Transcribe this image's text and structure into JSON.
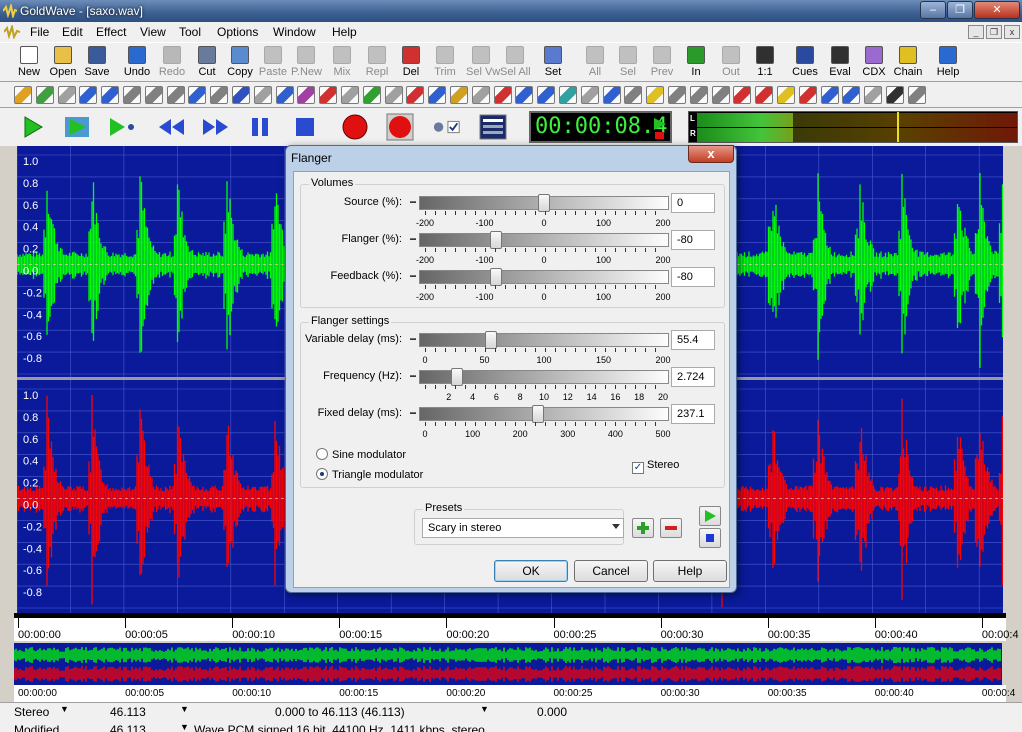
{
  "window": {
    "title": "GoldWave - [saxo.wav]",
    "min_glyph": "–",
    "max_glyph": "❐",
    "close_glyph": "✕"
  },
  "menu": [
    "File",
    "Edit",
    "Effect",
    "View",
    "Tool",
    "Options",
    "Window",
    "Help"
  ],
  "mdi": {
    "min": "_",
    "restore": "❐",
    "close": "x"
  },
  "toolbar": [
    {
      "label": "New",
      "icon": "new-file-icon",
      "color": "#ffffff",
      "enabled": true
    },
    {
      "label": "Open",
      "icon": "open-folder-icon",
      "color": "#e8c048",
      "enabled": true
    },
    {
      "label": "Save",
      "icon": "save-disk-icon",
      "color": "#3a5a9a",
      "enabled": true
    },
    {
      "label": "Undo",
      "icon": "undo-arrow-icon",
      "color": "#2a6ad0",
      "enabled": true
    },
    {
      "label": "Redo",
      "icon": "redo-arrow-icon",
      "color": "#b8b8b8",
      "enabled": false
    },
    {
      "label": "Cut",
      "icon": "scissors-icon",
      "color": "#6a7a9a",
      "enabled": true
    },
    {
      "label": "Copy",
      "icon": "copy-icon",
      "color": "#5a8ad0",
      "enabled": true
    },
    {
      "label": "Paste",
      "icon": "paste-icon",
      "color": "#c0c0c0",
      "enabled": false
    },
    {
      "label": "P.New",
      "icon": "paste-new-icon",
      "color": "#c0c0c0",
      "enabled": false
    },
    {
      "label": "Mix",
      "icon": "mix-icon",
      "color": "#c0c0c0",
      "enabled": false
    },
    {
      "label": "Repl",
      "icon": "replace-icon",
      "color": "#c0c0c0",
      "enabled": false
    },
    {
      "label": "Del",
      "icon": "delete-icon",
      "color": "#d03030",
      "enabled": true
    },
    {
      "label": "Trim",
      "icon": "trim-icon",
      "color": "#c0c0c0",
      "enabled": false
    },
    {
      "label": "Sel Vw",
      "icon": "select-view-icon",
      "color": "#c0c0c0",
      "enabled": false
    },
    {
      "label": "Sel All",
      "icon": "select-all-icon",
      "color": "#c0c0c0",
      "enabled": false
    },
    {
      "label": "Set",
      "icon": "set-marker-icon",
      "color": "#5a7ad0",
      "enabled": true
    },
    {
      "label": "All",
      "icon": "zoom-all-icon",
      "color": "#c0c0c0",
      "enabled": false
    },
    {
      "label": "Sel",
      "icon": "zoom-selection-icon",
      "color": "#c0c0c0",
      "enabled": false
    },
    {
      "label": "Prev",
      "icon": "zoom-previous-icon",
      "color": "#c0c0c0",
      "enabled": false
    },
    {
      "label": "In",
      "icon": "zoom-in-icon",
      "color": "#2a9a2a",
      "enabled": true
    },
    {
      "label": "Out",
      "icon": "zoom-out-icon",
      "color": "#c0c0c0",
      "enabled": false
    },
    {
      "label": "1:1",
      "icon": "zoom-one-to-one-icon",
      "color": "#303030",
      "enabled": true
    },
    {
      "label": "Cues",
      "icon": "cues-icon",
      "color": "#2a4aa0",
      "enabled": true
    },
    {
      "label": "Eval",
      "icon": "expression-evaluator-icon",
      "color": "#303030",
      "enabled": true
    },
    {
      "label": "CDX",
      "icon": "cd-extract-icon",
      "color": "#9a6ad0",
      "enabled": true
    },
    {
      "label": "Chain",
      "icon": "chain-wizard-icon",
      "color": "#e0c020",
      "enabled": true
    },
    {
      "label": "Help",
      "icon": "help-icon",
      "color": "#2a6ad0",
      "enabled": true
    }
  ],
  "effects_bar_colors": [
    "#e0a020",
    "#40a040",
    "#a0a0a0",
    "#3060d0",
    "#3060d0",
    "#808080",
    "#808080",
    "#808080",
    "#3060d0",
    "#808080",
    "#3050c0",
    "#a0a0a0",
    "#3060d0",
    "#a040a0",
    "#d03030",
    "#a0a0a0",
    "#30a030",
    "#a0a0a0",
    "#d03030",
    "#3060d0",
    "#d0a020",
    "#a0a0a0",
    "#d03030",
    "#3060d0",
    "#3060d0",
    "#30a0a0",
    "#a0a0a0",
    "#3060d0",
    "#808080",
    "#e0c020",
    "#808080",
    "#808080",
    "#808080",
    "#d03030",
    "#d03030",
    "#e0c020",
    "#d03030",
    "#3060d0",
    "#3060d0",
    "#a0a0a0",
    "#303030",
    "#808080"
  ],
  "transport": {
    "time": "00:00:08.4",
    "vu_left": "L",
    "vu_right": "R"
  },
  "waveform": {
    "left_color": "#00ff00",
    "right_color": "#ff0000",
    "background": "#0a1a9a",
    "amplitude_labels": [
      "1.0",
      "0.8",
      "0.6",
      "0.4",
      "0.2",
      "0.0",
      "-0.2",
      "-0.4",
      "-0.6",
      "-0.8"
    ],
    "duration_s": 46.113
  },
  "timeline": {
    "labels": [
      "00:00:00",
      "00:00:05",
      "00:00:10",
      "00:00:15",
      "00:00:20",
      "00:00:25",
      "00:00:30",
      "00:00:35",
      "00:00:40",
      "00:00:4"
    ]
  },
  "overview": {
    "labels": [
      "00:00:00",
      "00:00:05",
      "00:00:10",
      "00:00:15",
      "00:00:20",
      "00:00:25",
      "00:00:30",
      "00:00:35",
      "00:00:40",
      "00:00:4"
    ]
  },
  "status": {
    "row1": [
      "Stereo",
      "46.113",
      "0.000 to 46.113 (46.113)",
      "0.000"
    ],
    "row2": [
      "Modified",
      "46.113",
      "Wave PCM signed 16 bit, 44100 Hz, 1411 kbps, stereo"
    ]
  },
  "dialog": {
    "title": "Flanger",
    "close_glyph": "x",
    "volumes_group": "Volumes",
    "flanger_group": "Flanger settings",
    "presets_group": "Presets",
    "rows": [
      {
        "label": "Source (%):",
        "value": "0",
        "min": -200,
        "max": 200,
        "pos": 0,
        "ticks": [
          "-200",
          "-100",
          "0",
          "100",
          "200"
        ]
      },
      {
        "label": "Flanger (%):",
        "value": "-80",
        "min": -200,
        "max": 200,
        "pos": -80,
        "ticks": [
          "-200",
          "-100",
          "0",
          "100",
          "200"
        ]
      },
      {
        "label": "Feedback (%):",
        "value": "-80",
        "min": -200,
        "max": 200,
        "pos": -80,
        "ticks": [
          "-200",
          "-100",
          "0",
          "100",
          "200"
        ]
      },
      {
        "label": "Variable delay (ms):",
        "value": "55.4",
        "min": 0,
        "max": 200,
        "pos": 55.4,
        "ticks": [
          "0",
          "50",
          "100",
          "150",
          "200"
        ]
      },
      {
        "label": "Frequency (Hz):",
        "value": "2.724",
        "min": 0,
        "max": 20,
        "pos": 2.724,
        "ticks": [
          "2",
          "4",
          "6",
          "8",
          "10",
          "12",
          "14",
          "16",
          "18",
          "20"
        ]
      },
      {
        "label": "Fixed delay (ms):",
        "value": "237.1",
        "min": 0,
        "max": 500,
        "pos": 237.1,
        "ticks": [
          "0",
          "100",
          "200",
          "300",
          "400",
          "500"
        ]
      }
    ],
    "sine_label": "Sine modulator",
    "triangle_label": "Triangle modulator",
    "modulator": "triangle",
    "stereo_label": "Stereo",
    "stereo_checked": true,
    "preset_value": "Scary in stereo",
    "ok_label": "OK",
    "cancel_label": "Cancel",
    "help_label": "Help",
    "minus_glyph": "−",
    "plus_glyph": "+"
  }
}
